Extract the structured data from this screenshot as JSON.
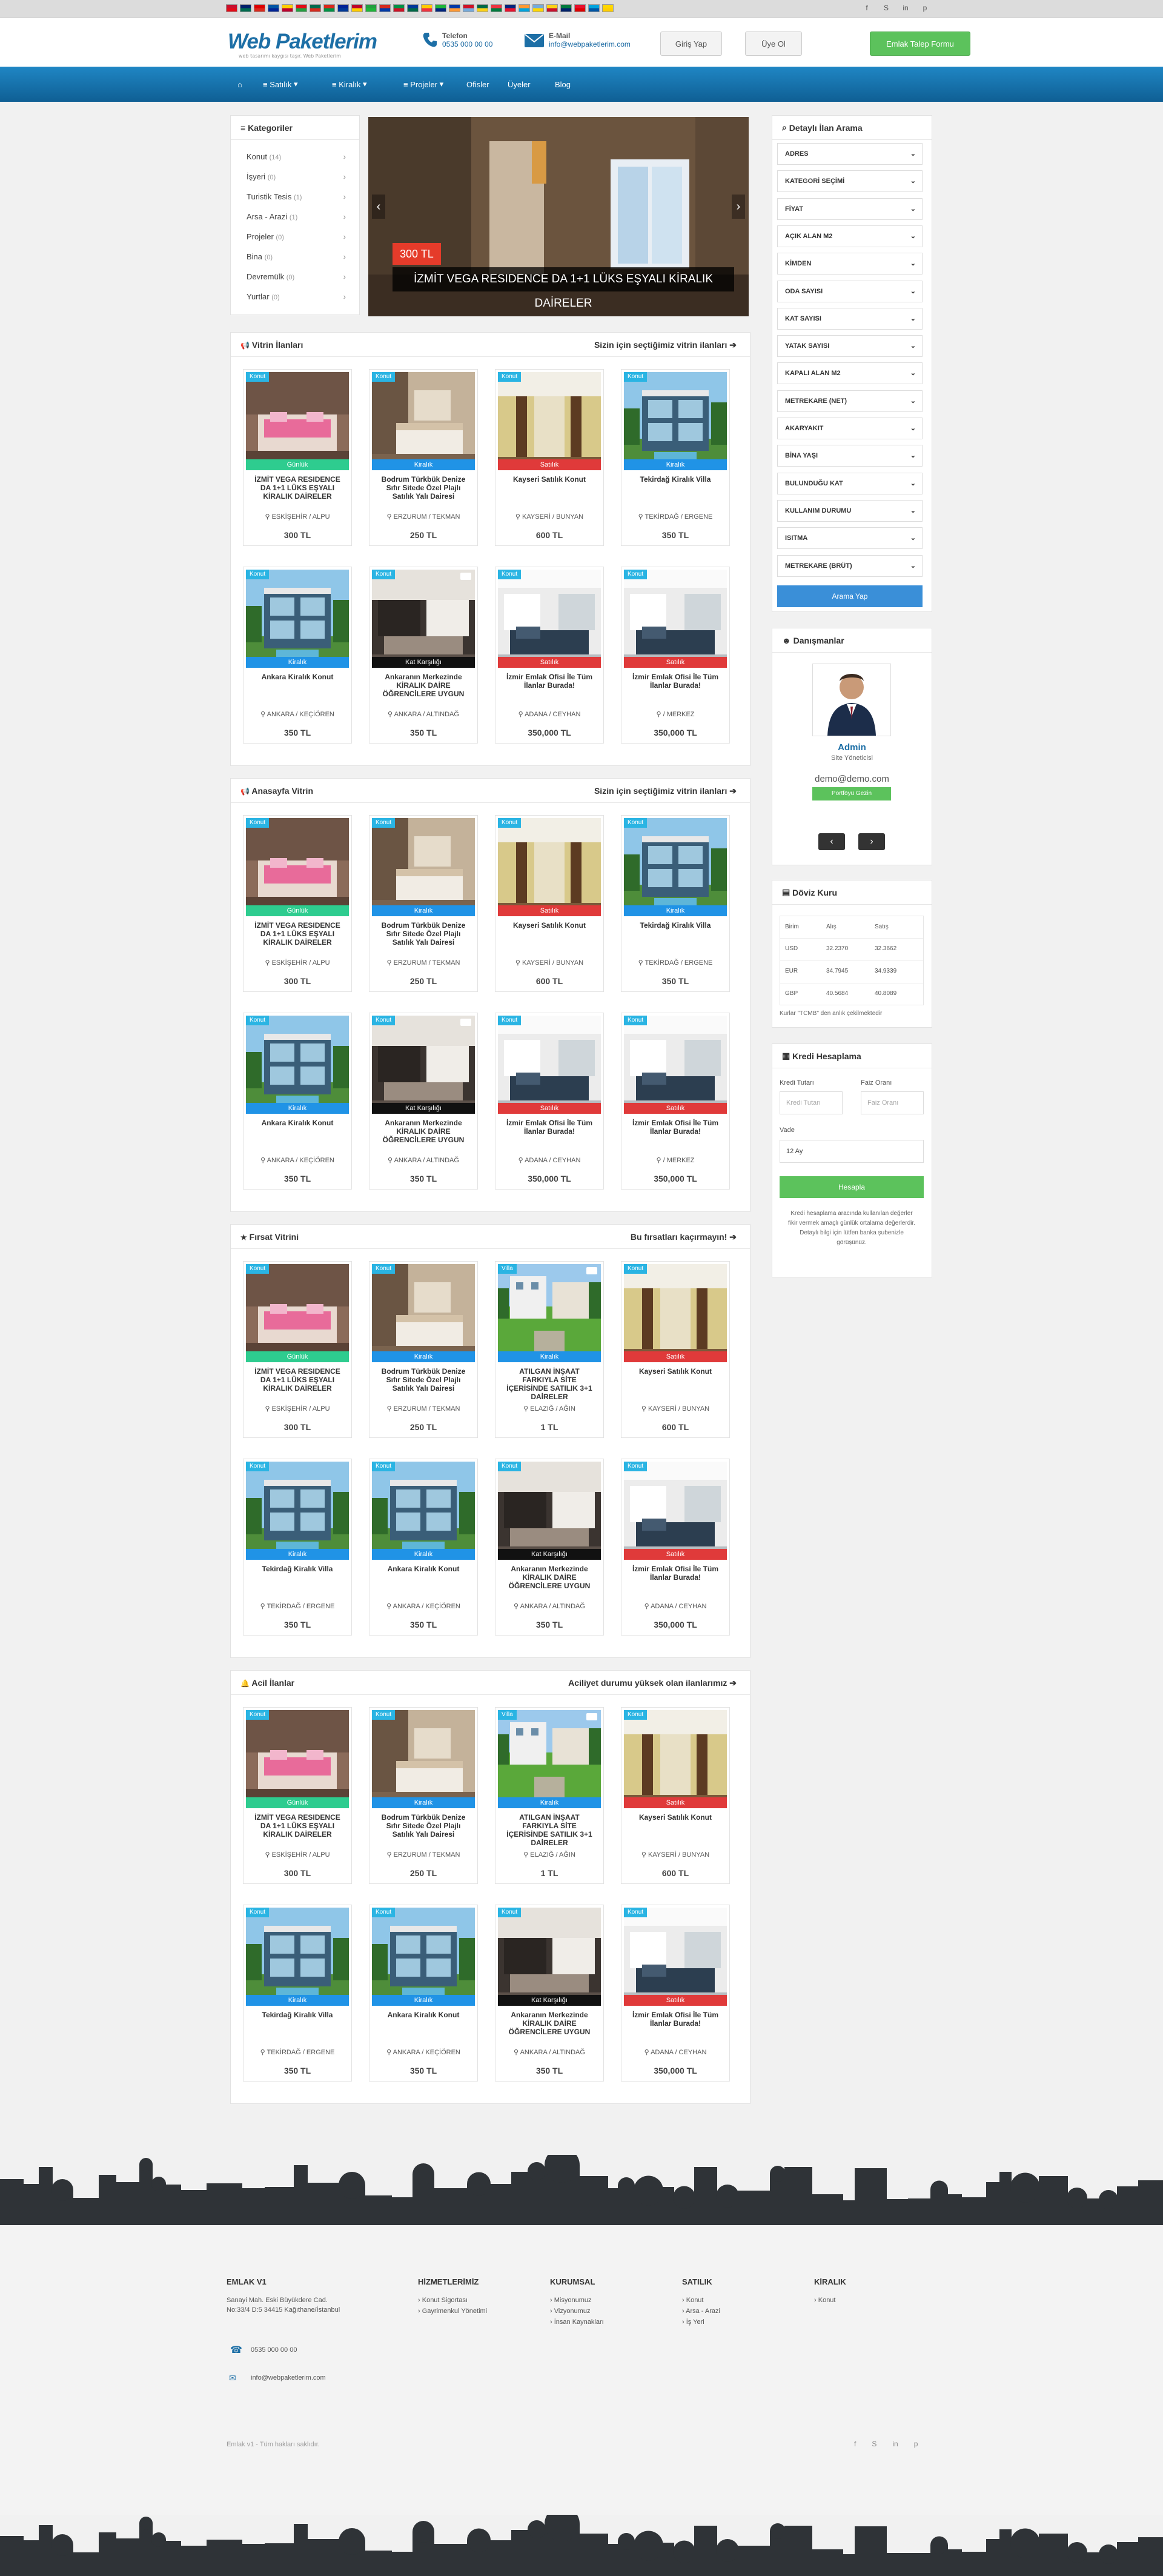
{
  "header": {
    "logo": "Web Paketlerim",
    "tagline": "web tasarımı kaygısı taşır. Web Paketlerim",
    "phone_label": "Telefon",
    "phone_value": "0535 000 00 00",
    "email_label": "E-Mail",
    "email_value": "info@webpaketlerim.com",
    "login": "Giriş Yap",
    "register": "Üye Ol",
    "request": "Emlak Talep Formu"
  },
  "nav": {
    "satilik": "Satılık",
    "kiralik": "Kiralık",
    "projeler": "Projeler",
    "ofisler": "Ofisler",
    "uyeler": "Üyeler",
    "blog": "Blog"
  },
  "categories": {
    "title": "Kategoriler",
    "items": [
      {
        "name": "Konut",
        "count": "(14)"
      },
      {
        "name": "İşyeri",
        "count": "(0)"
      },
      {
        "name": "Turistik Tesis",
        "count": "(1)"
      },
      {
        "name": "Arsa - Arazi",
        "count": "(1)"
      },
      {
        "name": "Projeler",
        "count": "(0)"
      },
      {
        "name": "Bina",
        "count": "(0)"
      },
      {
        "name": "Devremülk",
        "count": "(0)"
      },
      {
        "name": "Yurtlar",
        "count": "(0)"
      }
    ]
  },
  "slider": {
    "price": "300 TL",
    "title": "İZMİT VEGA RESIDENCE DA 1+1 LÜKS EŞYALI KİRALIK DAİRELER"
  },
  "sections": [
    {
      "title": "Vitrin İlanları",
      "right": "Sizin için seçtiğimiz vitrin ilanları"
    },
    {
      "title": "Anasayfa Vitrin",
      "right": "Sizin için seçtiğimiz vitrin ilanları"
    },
    {
      "title": "Fırsat Vitrini",
      "right": "Bu fırsatları kaçırmayın!"
    },
    {
      "title": "Acil İlanlar",
      "right": "Aciliyet durumu yüksek olan ilanlarımız"
    }
  ],
  "listings": {
    "izmit": {
      "badge": "Konut",
      "type": "Günlük",
      "title": "İZMİT VEGA RESIDENCE DA 1+1 LÜKS EŞYALI KİRALIK DAİRELER",
      "loc": "ESKİŞEHİR / ALPU",
      "price": "300 TL",
      "img": "bedroom-pink"
    },
    "bodrum": {
      "badge": "Konut",
      "type": "Kiralık",
      "title": "Bodrum Türkbük Denize Sıfır Sitede Özel Plajlı Satılık Yalı Dairesi",
      "loc": "ERZURUM / TEKMAN",
      "price": "250 TL",
      "img": "bedroom-beige"
    },
    "kayseri": {
      "badge": "Konut",
      "type": "Satılık",
      "title": "Kayseri Satılık Konut",
      "loc": "KAYSERİ / BUNYAN",
      "price": "600 TL",
      "img": "hall"
    },
    "tekirdag": {
      "badge": "Konut",
      "type": "Kiralık",
      "title": "Tekirdağ Kiralık Villa",
      "loc": "TEKİRDAĞ / ERGENE",
      "price": "350 TL",
      "img": "villa"
    },
    "ankara": {
      "badge": "Konut",
      "type": "Kiralık",
      "title": "Ankara Kiralık Konut",
      "loc": "ANKARA / KEÇİÖREN",
      "price": "350 TL",
      "img": "villa"
    },
    "ankaraogr": {
      "badge": "Konut",
      "type": "Kat Karşılığı",
      "title": "Ankaranın Merkezinde KİRALIK DAİRE ÖĞRENCİLERE UYGUN",
      "loc": "ANKARA / ALTINDAĞ",
      "price": "350 TL",
      "img": "kitchen"
    },
    "izmirA": {
      "badge": "Konut",
      "type": "Satılık",
      "title": "İzmir Emlak Ofisi İle Tüm İlanlar Burada!",
      "loc": "ADANA / CEYHAN",
      "price": "350,000 TL",
      "img": "office"
    },
    "izmirB": {
      "badge": "Konut",
      "type": "Satılık",
      "title": "İzmir Emlak Ofisi İle Tüm İlanlar Burada!",
      "loc": "/ MERKEZ",
      "price": "350,000 TL",
      "img": "office"
    },
    "atilgan": {
      "badge": "Villa",
      "type": "Kiralık",
      "title": "ATILGAN İNŞAAT FARKIYLA SİTE İÇERİSİNDE SATILIK 3+1 DAİRELER",
      "loc": "ELAZIĞ / AĞIN",
      "price": "1 TL",
      "img": "garden"
    }
  },
  "search": {
    "title": "Detaylı İlan Arama",
    "fields": [
      "ADRES",
      "KATEGORİ SEÇİMİ",
      "FİYAT",
      "AÇIK ALAN M2",
      "KİMDEN",
      "ODA SAYISI",
      "KAT SAYISI",
      "YATAK SAYISI",
      "KAPALI ALAN M2",
      "METREKARE (NET)",
      "AKARYAKIT",
      "BİNA YAŞI",
      "BULUNDUĞU KAT",
      "KULLANIM DURUMU",
      "ISITMA",
      "METREKARE (BRÜT)"
    ],
    "button": "Arama Yap"
  },
  "advisors": {
    "title": "Danışmanlar",
    "name": "Admin",
    "role": "Site Yöneticisi",
    "email": "demo@demo.com",
    "button": "Portföyü Gezin"
  },
  "fx": {
    "title": "Döviz Kuru",
    "headers": [
      "Birim",
      "Alış",
      "Satış"
    ],
    "rows": [
      [
        "USD",
        "32.2370",
        "32.3662"
      ],
      [
        "EUR",
        "34.7945",
        "34.9339"
      ],
      [
        "GBP",
        "40.5684",
        "40.8089"
      ]
    ],
    "note": "Kurlar \"TCMB\" den anlık çekilmektedir"
  },
  "credit": {
    "title": "Kredi Hesaplama",
    "amount_label": "Kredi Tutarı",
    "amount_ph": "Kredi Tutarı",
    "rate_label": "Faiz Oranı",
    "rate_ph": "Faiz Oranı",
    "term_label": "Vade",
    "term_value": "12 Ay",
    "button": "Hesapla",
    "note": "Kredi hesaplama aracında kullanılan değerler fikir vermek amaçlı günlük ortalama değerlerdir. Detaylı bilgi için lütfen banka şubenizle görüşünüz."
  },
  "footer": {
    "company": "EMLAK V1",
    "address1": "Sanayi Mah. Eski Büyükdere Cad.",
    "address2": "No:33/4 D:5 34415 Kağıthane/İstanbul",
    "phone": "0535 000 00 00",
    "email": "info@webpaketlerim.com",
    "services_title": "HİZMETLERİMİZ",
    "services": [
      "Konut Sigortası",
      "Gayrimenkul Yönetimi"
    ],
    "corp_title": "KURUMSAL",
    "corp": [
      "Misyonumuz",
      "Vizyonumuz",
      "İnsan Kaynakları"
    ],
    "sale_title": "SATILIK",
    "sale": [
      "Konut",
      "Arsa - Arazi",
      "İş Yeri"
    ],
    "rent_title": "KİRALIK",
    "rent": [
      "Konut"
    ],
    "copyright": "Emlak v1 - Tüm hakları saklıdır."
  },
  "colors": {
    "accent": "#1a73b0",
    "green": "#5cc25c",
    "gunluk": "#2ecc8f",
    "kiralik": "#2093e6",
    "satilik": "#e03a3a",
    "kat": "#111111",
    "badge": "#2ab4e3"
  }
}
